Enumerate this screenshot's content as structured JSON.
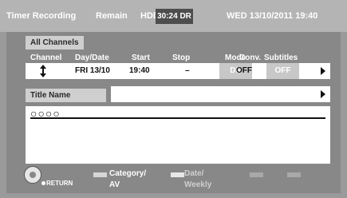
{
  "header": {
    "title": "Timer Recording",
    "remain_label": "Remain",
    "hdd_label": "HDD",
    "remaining_time": "30:24 DR",
    "datetime": "WED 13/10/2011 19:40"
  },
  "tabs": {
    "all_channels": "All Channels"
  },
  "columns": {
    "channel": "Channel",
    "day_date": "Day/Date",
    "start": "Start",
    "stop": "Stop",
    "mode": "Mode",
    "conv": "Conv.",
    "subtitles": "Subtitles"
  },
  "program": {
    "day_date": "FRI 13/10",
    "start": "19:40",
    "stop": "–",
    "mode": "DR",
    "conv": "OFF",
    "subtitles": "OFF"
  },
  "title_name": {
    "label": "Title Name",
    "value": "○○○○"
  },
  "footer": {
    "return_label": "RETURN",
    "category_label_line1": "Category/",
    "category_label_line2": "AV",
    "date_label_line1": "Date/",
    "date_label_line2": "Weekly"
  },
  "icons": {
    "channel_selector": "up-down-arrow-icon",
    "navigator": "navigator-icon",
    "row_arrow": "right-arrow-icon",
    "title_arrow": "right-arrow-icon"
  }
}
